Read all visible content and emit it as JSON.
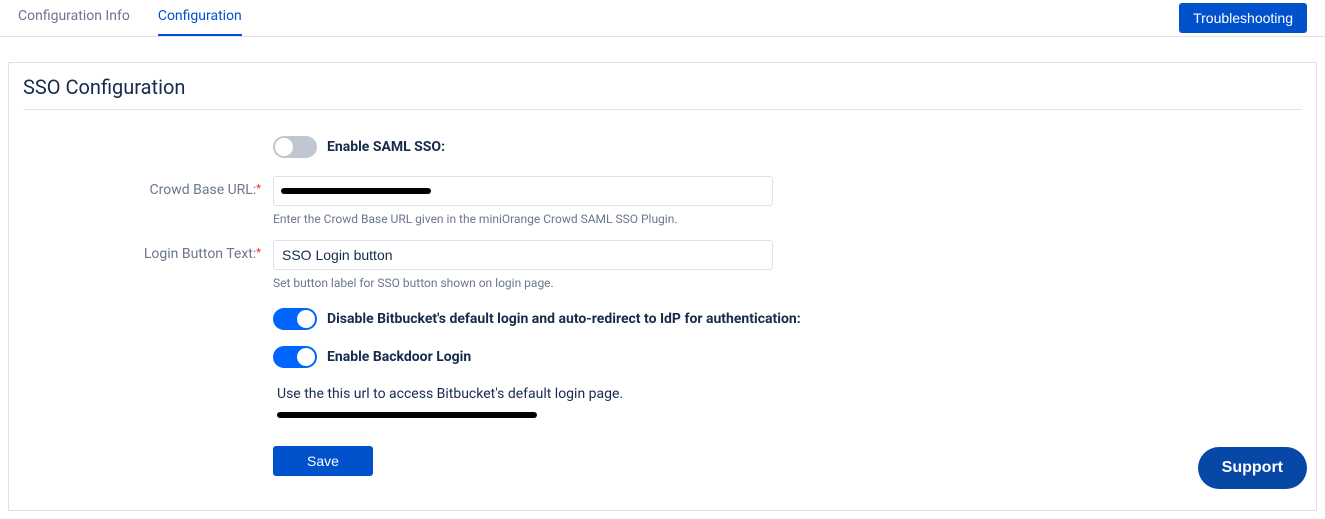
{
  "tabs": {
    "config_info": "Configuration Info",
    "configuration": "Configuration"
  },
  "troubleshooting_btn": "Troubleshooting",
  "panel": {
    "title": "SSO Configuration",
    "enable_saml_label": "Enable SAML SSO:",
    "crowd_url_label": "Crowd Base URL:",
    "crowd_url_value": "",
    "crowd_url_help": "Enter the Crowd Base URL given in the miniOrange Crowd SAML SSO Plugin.",
    "login_btn_text_label": "Login Button Text:",
    "login_btn_text_value": "SSO Login button",
    "login_btn_text_help": "Set button label for SSO button shown on login page.",
    "disable_default_login_label": "Disable Bitbucket's default login and auto-redirect to IdP for authentication:",
    "enable_backdoor_label": "Enable Backdoor Login",
    "backdoor_info": "Use the this url to access Bitbucket's default login page.",
    "save_btn": "Save"
  },
  "support_btn": "Support"
}
